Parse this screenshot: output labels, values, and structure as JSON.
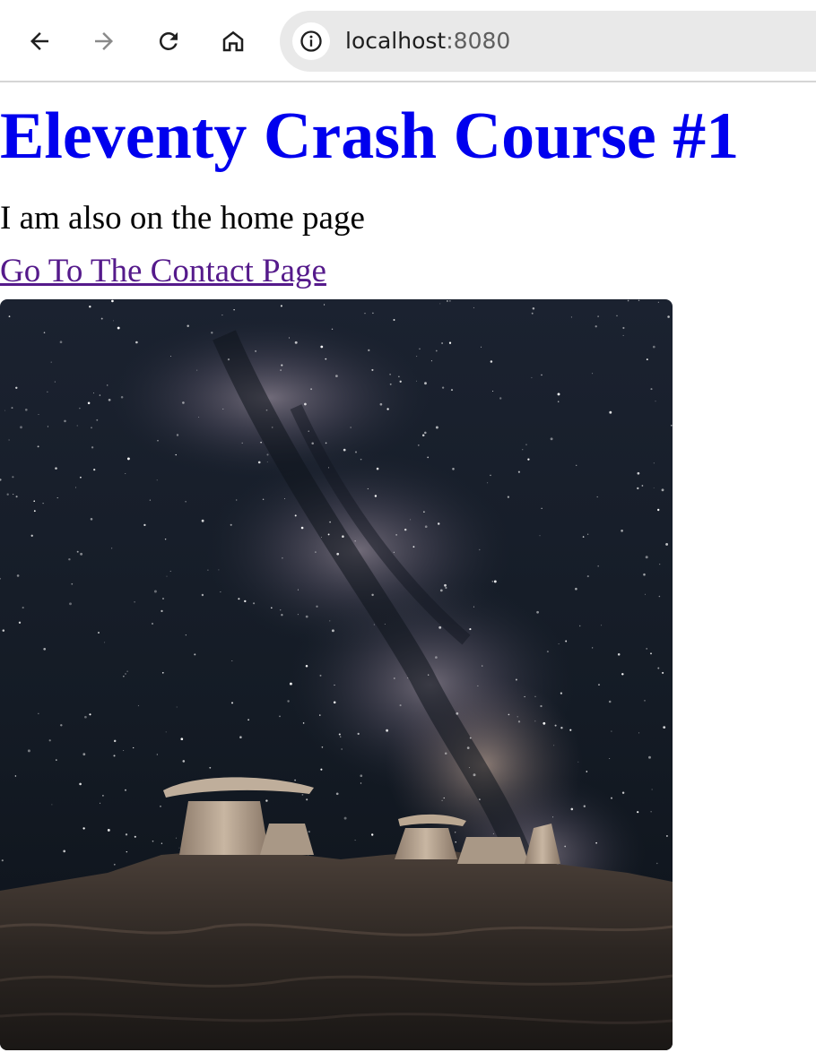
{
  "browser": {
    "url_host": "localhost",
    "url_port": ":8080",
    "icons": {
      "back": "arrow-left-icon",
      "forward": "arrow-right-icon",
      "reload": "reload-icon",
      "home": "home-icon",
      "site_info": "info-icon"
    }
  },
  "page": {
    "title": "Eleventy Crash Course #1",
    "paragraph": "I am also on the home page",
    "link_label": "Go To The Contact Page",
    "image": "milky-way-over-rock-formations"
  },
  "colors": {
    "title": "#0000ee",
    "visited_link": "#551a8b",
    "omnibox": "#e9e9e9"
  }
}
